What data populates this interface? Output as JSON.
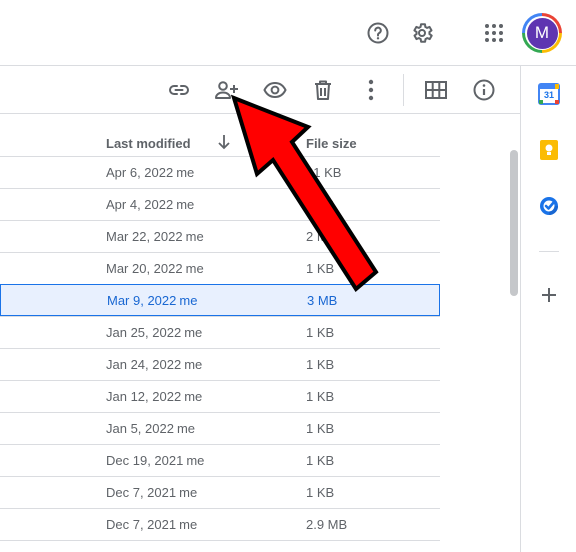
{
  "header": {
    "avatar_initial": "M",
    "help_icon": "help-circle-icon",
    "settings_icon": "gear-icon",
    "apps_icon": "apps-grid-icon"
  },
  "toolbar": {
    "icons": [
      "link-icon",
      "add-person-icon",
      "eye-icon",
      "trash-icon",
      "more-vert-icon",
      "grid-view-icon",
      "info-icon"
    ]
  },
  "table": {
    "columns": {
      "last_modified": "Last modified",
      "file_size": "File size"
    },
    "rows": [
      {
        "date": "Apr 6, 2022",
        "owner": "me",
        "size": "21 KB",
        "selected": false
      },
      {
        "date": "Apr 4, 2022",
        "owner": "me",
        "size": "3 KB",
        "selected": false
      },
      {
        "date": "Mar 22, 2022",
        "owner": "me",
        "size": "2 MB",
        "selected": false
      },
      {
        "date": "Mar 20, 2022",
        "owner": "me",
        "size": "1 KB",
        "selected": false
      },
      {
        "date": "Mar 9, 2022",
        "owner": "me",
        "size": "3 MB",
        "selected": true
      },
      {
        "date": "Jan 25, 2022",
        "owner": "me",
        "size": "1 KB",
        "selected": false
      },
      {
        "date": "Jan 24, 2022",
        "owner": "me",
        "size": "1 KB",
        "selected": false
      },
      {
        "date": "Jan 12, 2022",
        "owner": "me",
        "size": "1 KB",
        "selected": false
      },
      {
        "date": "Jan 5, 2022",
        "owner": "me",
        "size": "1 KB",
        "selected": false
      },
      {
        "date": "Dec 19, 2021",
        "owner": "me",
        "size": "1 KB",
        "selected": false
      },
      {
        "date": "Dec 7, 2021",
        "owner": "me",
        "size": "1 KB",
        "selected": false
      },
      {
        "date": "Dec 7, 2021",
        "owner": "me",
        "size": "2.9 MB",
        "selected": false
      }
    ]
  },
  "side_panel": {
    "calendar_day": "31",
    "icons": [
      "calendar-icon",
      "keep-icon",
      "tasks-icon",
      "add-icon"
    ]
  },
  "colors": {
    "accent": "#1a73e8",
    "selected_bg": "#e8f0fe",
    "arrow": "#ff0000"
  }
}
